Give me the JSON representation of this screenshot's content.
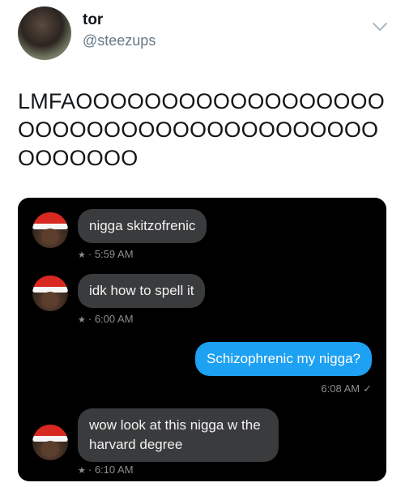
{
  "tweet": {
    "display_name": "tor",
    "handle": "@steezups",
    "text": "LMFAOOOOOOOOOOOOOOOOOOOOOOOOOOOOOOOOOOOOOOOOOOOOOO"
  },
  "dm_screenshot": {
    "messages": [
      {
        "direction": "incoming",
        "text": "nigga skitzofrenic",
        "time": "5:59 AM"
      },
      {
        "direction": "incoming",
        "text": "idk how to spell it",
        "time": "6:00 AM"
      },
      {
        "direction": "outgoing",
        "text": "Schizophrenic my nigga?",
        "time": "6:08 AM"
      },
      {
        "direction": "incoming",
        "text": "wow look at this nigga w the harvard degree",
        "time": "6:10 AM"
      }
    ],
    "colors": {
      "background": "#000000",
      "incoming_bubble": "#3a3b3d",
      "outgoing_bubble": "#1da1f2",
      "meta_text": "#8a8d91"
    }
  },
  "icons": {
    "chevron": "chevron-down-icon",
    "star": "star-icon",
    "read_receipt": "checkmark-icon"
  }
}
